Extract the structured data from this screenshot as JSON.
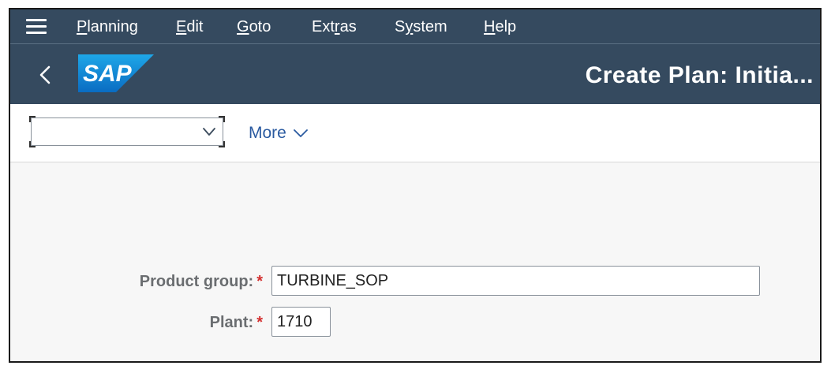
{
  "menu": {
    "items": [
      {
        "label": "Planning"
      },
      {
        "label": "Edit"
      },
      {
        "label": "Goto"
      },
      {
        "label": "Extras"
      },
      {
        "label": "System"
      },
      {
        "label": "Help"
      }
    ]
  },
  "header": {
    "logo_text": "SAP",
    "title": "Create Plan: Initia..."
  },
  "toolbar": {
    "combo_value": "",
    "more_label": "More"
  },
  "form": {
    "product_group_label": "Product group:",
    "product_group_value": "TURBINE_SOP",
    "plant_label": "Plant:",
    "plant_value": "1710",
    "required_marker": "*"
  },
  "colors": {
    "shell": "#354a5f",
    "link": "#2a5aa0",
    "required": "#d32f2f"
  }
}
